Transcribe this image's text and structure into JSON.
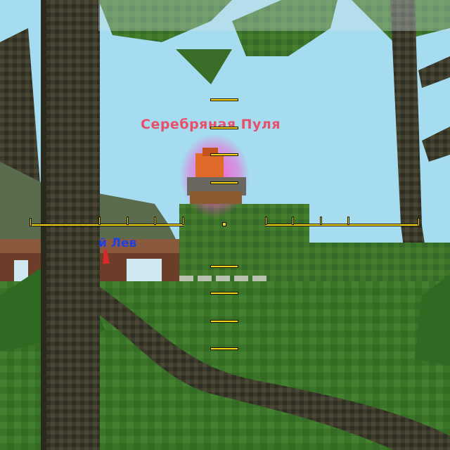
{
  "players": {
    "enemy_name": "Серебряная Пуля",
    "ally_name_partial": "й Лев"
  },
  "colors": {
    "sky": "#9fd8ee",
    "grass": "#3f7a2a",
    "grass_dark": "#2c5a1e",
    "trunk": "#3b3a2a",
    "enemy_tag": "#e8506a",
    "ally_tag": "#2040e0",
    "scope": "#f4d21e",
    "glow": "#ff4fd0"
  },
  "hud": {
    "scope_marks": 8,
    "dash_count": 6
  }
}
